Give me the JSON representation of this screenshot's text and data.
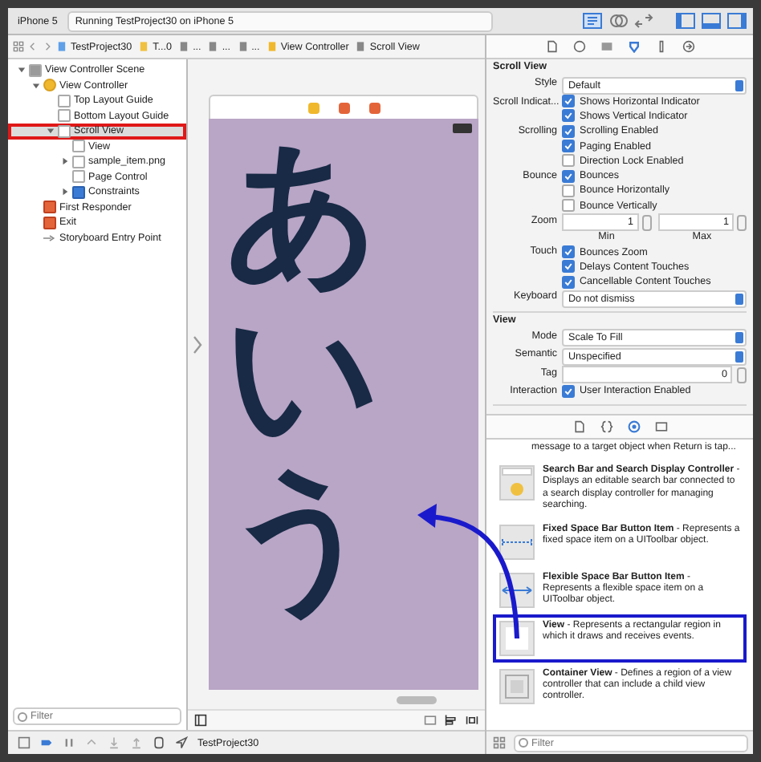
{
  "toolbar": {
    "scheme": "iPhone 5",
    "status": "Running TestProject30 on iPhone 5"
  },
  "jump_bar": [
    "TestProject30",
    "T...0",
    "...",
    "...",
    "...",
    "View Controller",
    "Scroll View"
  ],
  "outline": [
    {
      "label": "View Controller Scene",
      "kind": "scene",
      "expanded": true,
      "selected": false,
      "highlighted": false,
      "children": [
        {
          "label": "View Controller",
          "kind": "controller",
          "expanded": true,
          "selected": false,
          "highlighted": false,
          "children": [
            {
              "label": "Top Layout Guide",
              "kind": "view",
              "selected": false,
              "highlighted": false
            },
            {
              "label": "Bottom Layout Guide",
              "kind": "view",
              "selected": false,
              "highlighted": false
            },
            {
              "label": "Scroll View",
              "kind": "view",
              "expanded": true,
              "selected": true,
              "highlighted": true,
              "children": [
                {
                  "label": "View",
                  "kind": "view",
                  "selected": false,
                  "highlighted": false
                },
                {
                  "label": "sample_item.png",
                  "kind": "view",
                  "expanded": false,
                  "selected": false,
                  "highlighted": false
                },
                {
                  "label": "Page Control",
                  "kind": "view",
                  "selected": false,
                  "highlighted": false
                },
                {
                  "label": "Constraints",
                  "kind": "constraints",
                  "expanded": false,
                  "selected": false,
                  "highlighted": false
                }
              ]
            }
          ]
        },
        {
          "label": "First Responder",
          "kind": "responder",
          "selected": false,
          "highlighted": false
        },
        {
          "label": "Exit",
          "kind": "exit",
          "selected": false,
          "highlighted": false
        },
        {
          "label": "Storyboard Entry Point",
          "kind": "entry",
          "selected": false,
          "highlighted": false
        }
      ]
    }
  ],
  "navigator_filter": {
    "placeholder": "Filter"
  },
  "canvas": {
    "big_text": "あいう"
  },
  "inspector": {
    "sections": [
      {
        "title": "Scroll View",
        "rows": [
          {
            "kind": "select",
            "label": "Style",
            "value": "Default"
          },
          {
            "kind": "checks",
            "label": "Scroll Indicat...",
            "items": [
              {
                "label": "Shows Horizontal Indicator",
                "checked": true
              },
              {
                "label": "Shows Vertical Indicator",
                "checked": true
              }
            ]
          },
          {
            "kind": "checks",
            "label": "Scrolling",
            "items": [
              {
                "label": "Scrolling Enabled",
                "checked": true
              },
              {
                "label": "Paging Enabled",
                "checked": true
              },
              {
                "label": "Direction Lock Enabled",
                "checked": false
              }
            ]
          },
          {
            "kind": "checks",
            "label": "Bounce",
            "items": [
              {
                "label": "Bounces",
                "checked": true
              },
              {
                "label": "Bounce Horizontally",
                "checked": false
              },
              {
                "label": "Bounce Vertically",
                "checked": false
              }
            ]
          },
          {
            "kind": "steppers",
            "label": "Zoom",
            "fields": [
              {
                "value": "1",
                "caption": "Min"
              },
              {
                "value": "1",
                "caption": "Max"
              }
            ]
          },
          {
            "kind": "checks",
            "label": "Touch",
            "items": [
              {
                "label": "Bounces Zoom",
                "checked": true
              },
              {
                "label": "Delays Content Touches",
                "checked": true
              },
              {
                "label": "Cancellable Content Touches",
                "checked": true
              }
            ]
          },
          {
            "kind": "select",
            "label": "Keyboard",
            "value": "Do not dismiss"
          }
        ]
      },
      {
        "title": "View",
        "rows": [
          {
            "kind": "select",
            "label": "Mode",
            "value": "Scale To Fill"
          },
          {
            "kind": "select",
            "label": "Semantic",
            "value": "Unspecified"
          },
          {
            "kind": "stepper",
            "label": "Tag",
            "value": "0"
          },
          {
            "kind": "checks",
            "label": "Interaction",
            "items": [
              {
                "label": "User Interaction Enabled",
                "checked": true
              }
            ]
          }
        ]
      }
    ]
  },
  "library": [
    {
      "kind": "cut",
      "text": "message to a target object when Return is tap...",
      "highlighted": false
    },
    {
      "kind": "searchbar",
      "title": "Search Bar and Search Display Controller",
      "text": " - Displays an editable search bar connected to a search display controller for managing searching.",
      "highlighted": false
    },
    {
      "kind": "fixedspace",
      "title": "Fixed Space Bar Button Item",
      "text": " - Represents a fixed space item on a UIToolbar object.",
      "highlighted": false
    },
    {
      "kind": "flexspace",
      "title": "Flexible Space Bar Button Item",
      "text": " - Represents a flexible space item on a UIToolbar object.",
      "highlighted": false
    },
    {
      "kind": "view",
      "title": "View",
      "text": " - Represents a rectangular region in which it draws and receives events.",
      "highlighted": true
    },
    {
      "kind": "container",
      "title": "Container View",
      "text": " - Defines a region of a view controller that can include a child view controller.",
      "highlighted": false
    }
  ],
  "library_filter": {
    "placeholder": "Filter"
  },
  "debug_bar": {
    "target": "TestProject30"
  }
}
